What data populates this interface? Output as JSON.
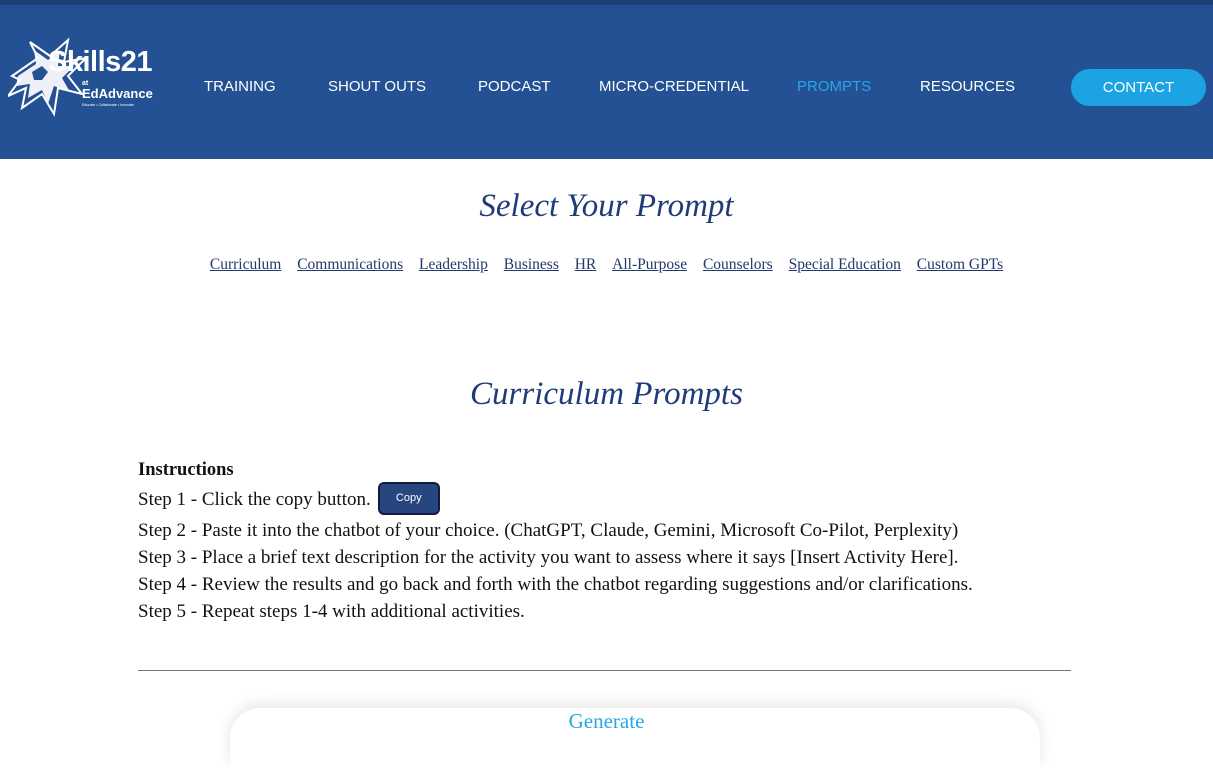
{
  "header": {
    "logo": {
      "name": "Skills21",
      "at": "at",
      "org": "EdAdvance",
      "tagline": "Educate • Collaborate • Innovate"
    },
    "nav": [
      {
        "label": "TRAINING",
        "active": false
      },
      {
        "label": "SHOUT OUTS",
        "active": false
      },
      {
        "label": "PODCAST",
        "active": false
      },
      {
        "label": "MICRO-CREDENTIAL",
        "active": false
      },
      {
        "label": "PROMPTS",
        "active": true
      },
      {
        "label": "RESOURCES",
        "active": false
      }
    ],
    "contact_label": "CONTACT"
  },
  "select_title": "Select Your Prompt",
  "prompt_links": [
    "Curriculum",
    "Communications",
    "Leadership",
    "Business",
    "HR",
    "All-Purpose",
    "Counselors",
    "Special Education",
    "Custom GPTs"
  ],
  "section_title": "Curriculum Prompts",
  "instructions": {
    "heading": "Instructions",
    "steps": [
      "Step 1 - Click the copy button.",
      "Step 2 - Paste it into the chatbot of your choice. (ChatGPT, Claude, Gemini, Microsoft Co-Pilot, Perplexity)",
      "Step 3 - Place a brief text description for the activity you want to assess where it says [Insert Activity Here].",
      "Step 4 - Review the results and go back and forth with the chatbot regarding suggestions and/or clarifications.",
      "Step 5 - Repeat steps 1-4 with additional activities."
    ],
    "copy_label": "Copy"
  },
  "generate_label": "Generate",
  "colors": {
    "header_bg": "#245194",
    "accent": "#1ba3e4",
    "title": "#1f3b78",
    "copy_button": "#27457f"
  }
}
